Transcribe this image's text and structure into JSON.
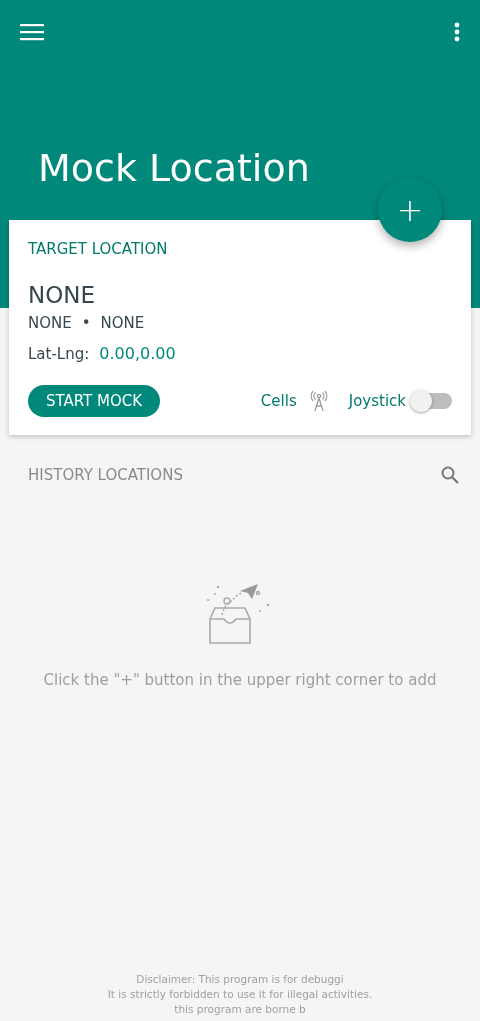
{
  "app_bar": {
    "title": "Mock Location",
    "fab_label": "+"
  },
  "target_card": {
    "heading": "TARGET LOCATION",
    "name": "NONE",
    "detail_1": "NONE",
    "separator": "•",
    "detail_2": "NONE",
    "latlng_label": "Lat-Lng:",
    "latlng_value": "0.00,0.00",
    "start_button": "START MOCK",
    "cells_label": "Cells",
    "joystick_label": "Joystick",
    "joystick_on": false
  },
  "history": {
    "heading": "HISTORY LOCATIONS",
    "empty_hint": "Click the \"+\" button in the upper right corner to add"
  },
  "disclaimer": [
    "Disclaimer: This program is for debuggi",
    "It is strictly forbidden to use it for illegal activities.",
    "this program are borne b"
  ]
}
